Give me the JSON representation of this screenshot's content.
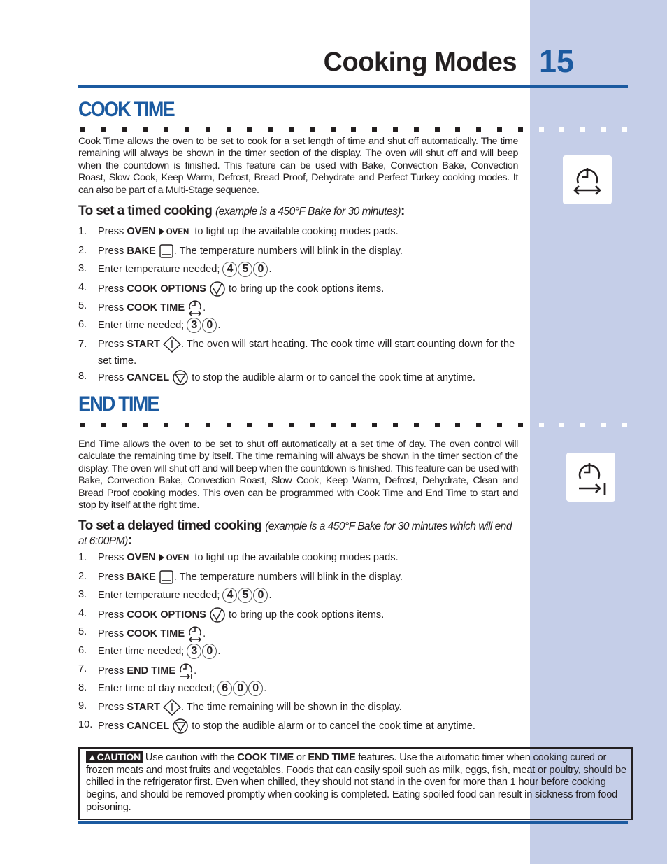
{
  "header": {
    "title": "Cooking Modes",
    "page_number": "15"
  },
  "accent_color": "#1b5aa0",
  "sidebar_color": "#c5cee8",
  "cook_time": {
    "heading": "COOK TIME",
    "icon": "cook-time-clock-double-arrow-icon",
    "description": "Cook Time allows the oven to be set to cook for a set length of time and shut off automatically. The time remaining will always be shown in the timer section of the display. The oven will shut off and will beep when the countdown is finished. This feature can be used with Bake, Convection Bake, Convection Roast, Slow Cook, Keep Warm, Defrost, Bread Proof, Dehydrate and Perfect Turkey cooking modes. It can also be part of a Multi-Stage sequence.",
    "subheading": "To set a timed cooking",
    "example": "(example is a 450°F Bake for 30 minutes)",
    "colon": ":",
    "steps": [
      {
        "num": "1.",
        "pre": "Press ",
        "key": "OVEN",
        "key2": "OVEN",
        "post": " to light up the available cooking modes pads."
      },
      {
        "num": "2.",
        "pre": "Press ",
        "key": "BAKE",
        "post": ". The temperature numbers will blink in the display."
      },
      {
        "num": "3.",
        "pre": "Enter temperature needed; ",
        "digits": [
          "4",
          "5",
          "0"
        ],
        "post": "."
      },
      {
        "num": "4.",
        "pre": "Press ",
        "key": "COOK OPTIONS",
        "post": " to bring up the cook options items."
      },
      {
        "num": "5.",
        "pre": "Press ",
        "key": "COOK TIME",
        "post": "."
      },
      {
        "num": "6.",
        "pre": "Enter time needed; ",
        "digits": [
          "3",
          "0"
        ],
        "post": "."
      },
      {
        "num": "7.",
        "pre": "Press ",
        "key": "START",
        "post": ". The oven will start heating. The cook time will start counting down for the set time."
      },
      {
        "num": "8.",
        "pre": "Press ",
        "key": "CANCEL",
        "post": " to stop the audible alarm or to cancel the cook time at anytime."
      }
    ]
  },
  "end_time": {
    "heading": "END TIME",
    "icon": "end-time-clock-arrow-bar-icon",
    "description": "End Time allows the oven to be set to shut off automatically at a set time of day. The oven control will calculate the remaining time by itself. The time remaining will always be shown in the timer section of the display. The oven will shut off and will beep when the countdown is finished. This feature can be used with Bake, Convection Bake, Convection Roast, Slow Cook, Keep Warm, Defrost, Dehydrate, Clean  and Bread Proof cooking modes. This oven can be programmed with Cook Time and End Time to start and stop by itself at the right time.",
    "subheading": "To set a delayed timed cooking",
    "example": "(example is a 450°F Bake for 30 minutes which will end at 6:00PM)",
    "colon": ":",
    "steps": [
      {
        "num": "1.",
        "pre": "Press ",
        "key": "OVEN",
        "key2": "OVEN",
        "post": " to light up the available cooking modes pads."
      },
      {
        "num": "2.",
        "pre": "Press ",
        "key": "BAKE",
        "post": ". The temperature numbers will blink in the display."
      },
      {
        "num": "3.",
        "pre": "Enter temperature needed; ",
        "digits": [
          "4",
          "5",
          "0"
        ],
        "post": "."
      },
      {
        "num": "4.",
        "pre": "Press ",
        "key": "COOK OPTIONS",
        "post": "  to bring up the cook options items."
      },
      {
        "num": "5.",
        "pre": "Press ",
        "key": "COOK TIME",
        "post": "."
      },
      {
        "num": "6.",
        "pre": "Enter time needed; ",
        "digits": [
          "3",
          "0"
        ],
        "post": "."
      },
      {
        "num": "7.",
        "pre": "Press ",
        "key": "END TIME",
        "post": "."
      },
      {
        "num": "8.",
        "pre": "Enter time of day needed; ",
        "digits": [
          "6",
          "0",
          "0"
        ],
        "post": "."
      },
      {
        "num": "9.",
        "pre": "Press ",
        "key": "START",
        "post": ". The time remaining will be shown in the display."
      },
      {
        "num": "10.",
        "pre": "Press ",
        "key": "CANCEL",
        "post": " to stop the audible alarm or to cancel the cook time at anytime."
      }
    ]
  },
  "caution": {
    "badge": "CAUTION",
    "t1": " Use caution with the ",
    "b1": "COOK TIME",
    "t2": " or ",
    "b2": "END TIME",
    "t3": " features. Use the automatic timer when cooking cured or frozen meats and most fruits and vegetables. Foods that can easily spoil such as milk, eggs, fish, meat or poultry, should be chilled in the refrigerator first. Even when chilled, they should not stand in the oven for more than 1 hour before cooking begins, and should be removed promptly when cooking is completed. Eating spoiled food can result in sickness from food poisoning."
  }
}
